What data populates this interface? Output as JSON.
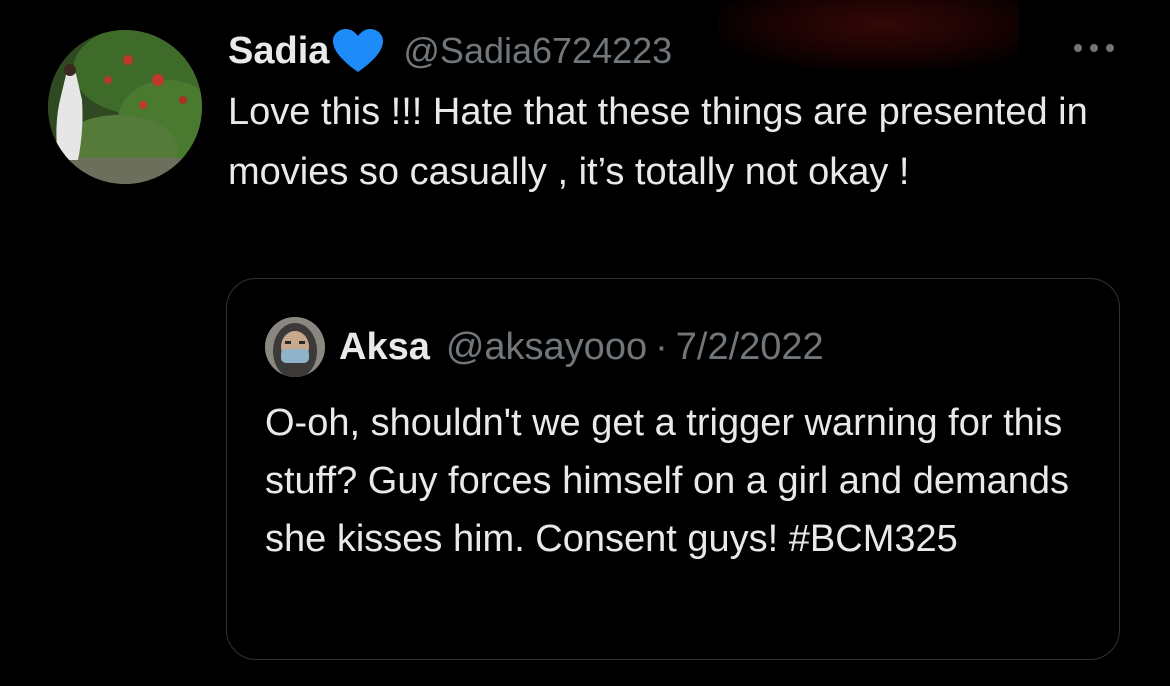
{
  "tweet": {
    "author": {
      "display_name": "Sadia",
      "badge_icon": "blue-heart-icon",
      "handle": "@Sadia6724223"
    },
    "more_icon": "more-horizontal-icon",
    "text": "Love this !!! Hate that these things are presented in movies so casually , it’s totally not okay !"
  },
  "quoted_tweet": {
    "author": {
      "display_name": "Aksa",
      "handle": "@aksayooo",
      "separator": "·",
      "date": "7/2/2022"
    },
    "text": "O-oh, shouldn't we get a trigger warning for this stuff? Guy forces himself on a girl and demands she kisses him. Consent guys! #BCM325"
  },
  "colors": {
    "background": "#000000",
    "primary_text": "#e7e9ea",
    "secondary_text": "#71767b",
    "border": "#2f3336",
    "heart": "#1d8cf8"
  }
}
